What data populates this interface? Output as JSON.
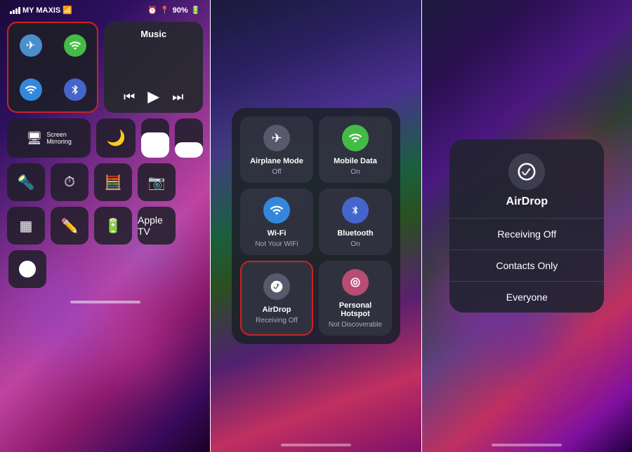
{
  "left": {
    "status": {
      "carrier": "MY MAXIS",
      "battery": "90%",
      "wifi_icon": "wifi",
      "alarm_icon": "alarm"
    },
    "connectivity": {
      "airplane": {
        "icon": "✈",
        "active": true
      },
      "cellular": {
        "icon": "📶",
        "active": true
      },
      "wifi": {
        "icon": "wifi",
        "active": true
      },
      "bluetooth": {
        "icon": "bluetooth",
        "active": true
      }
    },
    "music": {
      "title": "Music",
      "prev": "«",
      "play": "▶",
      "next": "»"
    },
    "screen_mirror_label": "Screen\nMirroring",
    "moon_label": "",
    "icons_row1": [
      "flashlight",
      "timer",
      "calculator",
      "camera"
    ],
    "icons_row2": [
      "qr",
      "edit",
      "battery",
      "appletv"
    ],
    "record_label": ""
  },
  "middle": {
    "tiles": [
      {
        "id": "airplane",
        "label": "Airplane Mode",
        "sublabel": "Off",
        "icon_type": "gray"
      },
      {
        "id": "mobile-data",
        "label": "Mobile Data",
        "sublabel": "On",
        "icon_type": "green"
      },
      {
        "id": "wifi",
        "label": "Wi-Fi",
        "sublabel": "Not Your WiFi",
        "icon_type": "blue"
      },
      {
        "id": "bluetooth",
        "label": "Bluetooth",
        "sublabel": "On",
        "icon_type": "blue2"
      },
      {
        "id": "airdrop",
        "label": "AirDrop",
        "sublabel": "Receiving Off",
        "icon_type": "gray",
        "outlined": true
      },
      {
        "id": "hotspot",
        "label": "Personal Hotspot",
        "sublabel": "Not Discoverable",
        "icon_type": "pink"
      }
    ]
  },
  "right": {
    "popup_title": "AirDrop",
    "options": [
      "Receiving Off",
      "Contacts Only",
      "Everyone"
    ]
  }
}
